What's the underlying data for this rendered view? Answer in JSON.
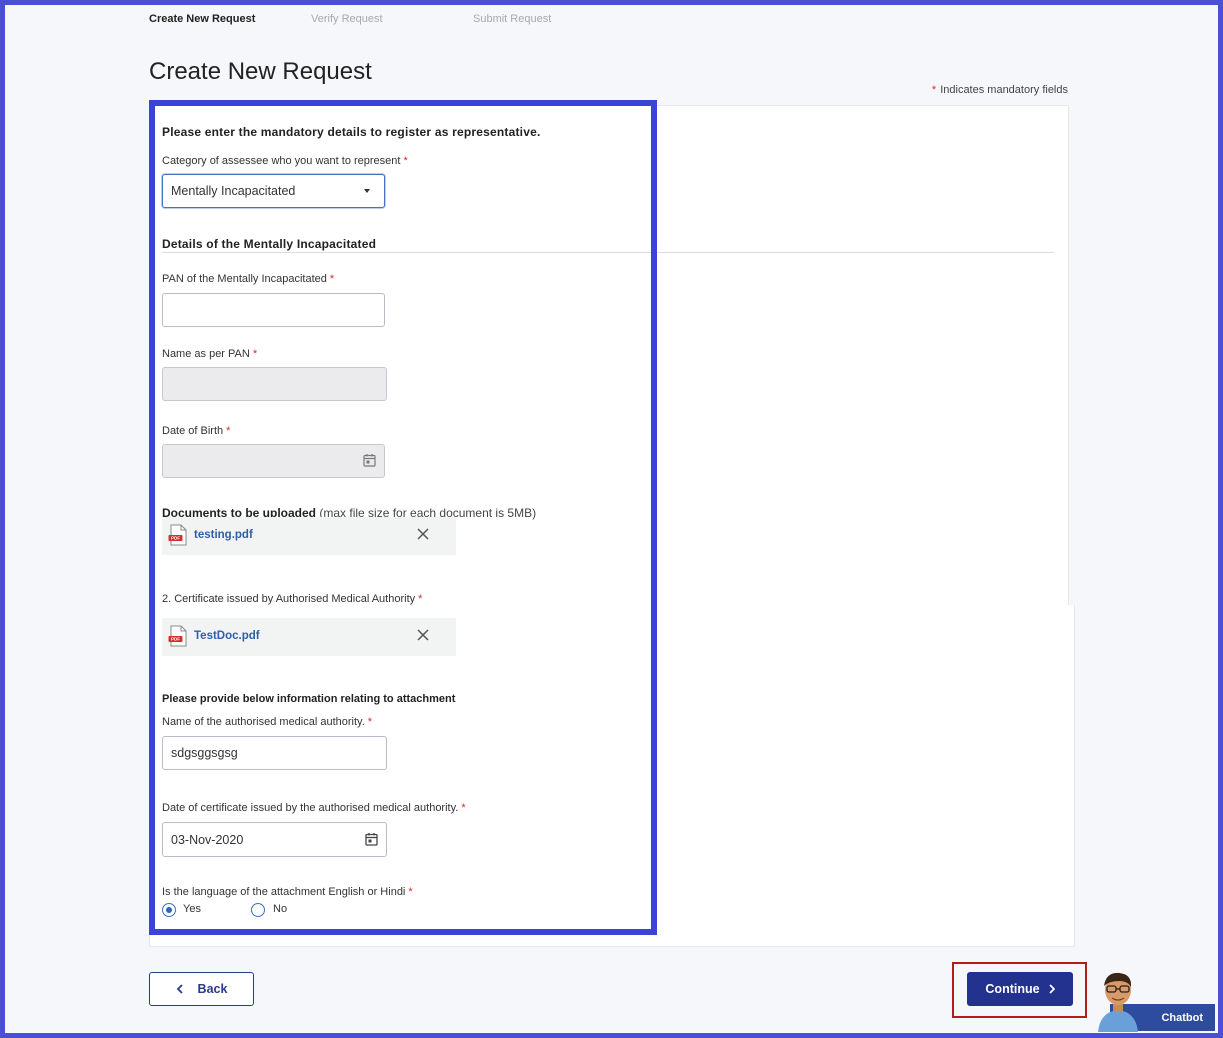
{
  "stepper": {
    "steps": [
      {
        "label": "Create New Request"
      },
      {
        "label": "Verify Request"
      },
      {
        "label": "Submit Request"
      }
    ]
  },
  "page_title": "Create New Request",
  "mandatory_note": "Indicates mandatory fields",
  "required_marker": "*",
  "form": {
    "intro": "Please enter the mandatory details to register as representative.",
    "category_label": "Category of assessee who you want to represent",
    "category_value": "Mentally Incapacitated",
    "details_heading": "Details of the Mentally Incapacitated",
    "pan_label": "PAN of the Mentally Incapacitated",
    "pan_value": "",
    "name_label": "Name as per PAN",
    "dob_label": "Date of Birth",
    "documents_heading": "Documents to be uploaded",
    "documents_note": "(max file size for each document is 5MB)",
    "file1": "testing.pdf",
    "certificate_label": "2. Certificate issued by Authorised Medical Authority",
    "file2": "TestDoc.pdf",
    "attachment_heading": "Please provide below information relating to attachment",
    "authority_label": "Name of the authorised medical authority.",
    "authority_value": "sdgsggsgsg",
    "cert_date_label": "Date of certificate issued by the authorised medical authority.",
    "cert_date_value": "03-Nov-2020",
    "language_question": "Is the language of the attachment English or Hindi",
    "option_yes": "Yes",
    "option_no": "No",
    "selected_option": "Yes"
  },
  "buttons": {
    "back": "Back",
    "continue": "Continue"
  },
  "chatbot": {
    "label": "Chatbot"
  },
  "colors": {
    "highlight_border": "#3b43d8",
    "continue_highlight": "#b11d1d",
    "primary_button": "#23318f",
    "required": "#d62828",
    "file_link": "#2e5ea8"
  }
}
